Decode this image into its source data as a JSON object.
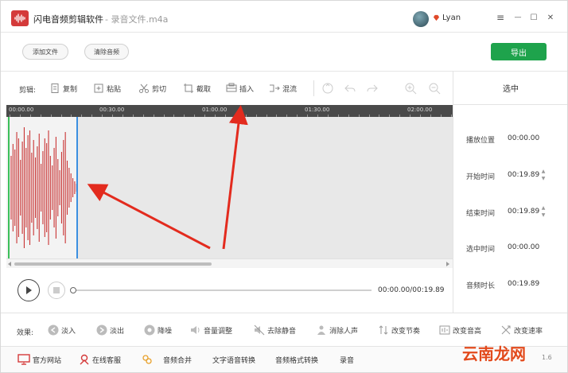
{
  "app": {
    "title": "闪电音频剪辑软件",
    "file_title": "- 录音文件.m4a",
    "username": "Lyan",
    "version": "1.6",
    "brand_color": "#d43a3a",
    "accent_color": "#1ea34c"
  },
  "window_controls": {
    "menu": "≡",
    "minimize": "—",
    "maximize": "☐",
    "close": "✕"
  },
  "top_actions": {
    "add_file": "添加文件",
    "clear_audio": "清除音频",
    "export": "导出"
  },
  "toolbar": {
    "label": "剪辑:",
    "copy": "复制",
    "paste": "粘贴",
    "cut": "剪切",
    "trim": "截取",
    "insert": "插入",
    "mix": "混流"
  },
  "timeline": {
    "ticks": [
      "00:00.00",
      "00:30.00",
      "01:00.00",
      "01:30.00",
      "02:00.00"
    ]
  },
  "selection_panel": {
    "header": "选中",
    "play_position_label": "播放位置",
    "play_position": "00:00.00",
    "start_time_label": "开始时间",
    "start_time": "00:19.89",
    "end_time_label": "结束时间",
    "end_time": "00:19.89",
    "selected_time_label": "选中时间",
    "selected_time": "00:00.00",
    "duration_label": "音频时长",
    "duration": "00:19.89"
  },
  "player": {
    "time_display": "00:00.00/00:19.89",
    "progress": 0
  },
  "effects": {
    "label": "效果:",
    "items": [
      "淡入",
      "淡出",
      "降噪",
      "音量调整",
      "去除静音",
      "消除人声",
      "改变节奏",
      "改变音高",
      "改变速率"
    ]
  },
  "footer": {
    "website": "官方网站",
    "support": "在线客服",
    "merge": "音频合并",
    "tts": "文字语音转换",
    "format": "音频格式转换",
    "record": "录音"
  },
  "watermark": "云南龙网"
}
